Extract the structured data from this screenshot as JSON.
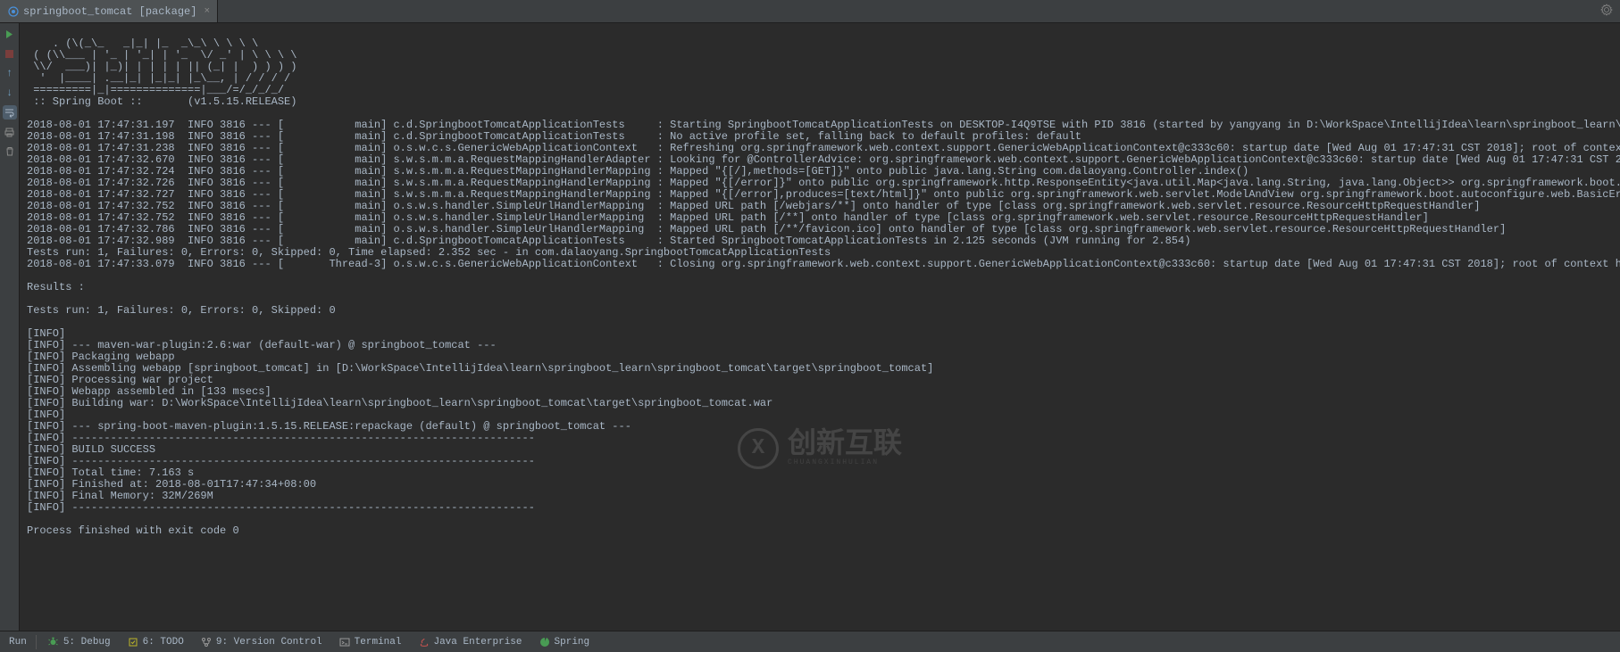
{
  "tab": {
    "label": "springboot_tomcat [package]"
  },
  "console_output": ". (\\(_\\_   _|_| |_  _\\_\\ \\ \\ \\ \\\n ( (\\\\___ | '_ | '_| | '_  \\/ _' | \\ \\ \\ \\\n \\\\/  ___)| |_)| | | | | || (_| |  ) ) ) )\n  '  |____| .__|_| |_|_| |_\\__, | / / / /\n =========|_|==============|___/=/_/_/_/\n :: Spring Boot ::       (v1.5.15.RELEASE)\n\n2018-08-01 17:47:31.197  INFO 3816 --- [           main] c.d.SpringbootTomcatApplicationTests     : Starting SpringbootTomcatApplicationTests on DESKTOP-I4Q9TSE with PID 3816 (started by yangyang in D:\\WorkSpace\\IntellijIdea\\learn\\springboot_learn\\spring\n2018-08-01 17:47:31.198  INFO 3816 --- [           main] c.d.SpringbootTomcatApplicationTests     : No active profile set, falling back to default profiles: default\n2018-08-01 17:47:31.238  INFO 3816 --- [           main] o.s.w.c.s.GenericWebApplicationContext   : Refreshing org.springframework.web.context.support.GenericWebApplicationContext@c333c60: startup date [Wed Aug 01 17:47:31 CST 2018]; root of context hier\n2018-08-01 17:47:32.670  INFO 3816 --- [           main] s.w.s.m.m.a.RequestMappingHandlerAdapter : Looking for @ControllerAdvice: org.springframework.web.context.support.GenericWebApplicationContext@c333c60: startup date [Wed Aug 01 17:47:31 CST 2018]; \n2018-08-01 17:47:32.724  INFO 3816 --- [           main] s.w.s.m.m.a.RequestMappingHandlerMapping : Mapped \"{[/],methods=[GET]}\" onto public java.lang.String com.dalaoyang.Controller.index()\n2018-08-01 17:47:32.726  INFO 3816 --- [           main] s.w.s.m.m.a.RequestMappingHandlerMapping : Mapped \"{[/error]}\" onto public org.springframework.http.ResponseEntity<java.util.Map<java.lang.String, java.lang.Object>> org.springframework.boot.autoc\n2018-08-01 17:47:32.727  INFO 3816 --- [           main] s.w.s.m.m.a.RequestMappingHandlerMapping : Mapped \"{[/error],produces=[text/html]}\" onto public org.springframework.web.servlet.ModelAndView org.springframework.boot.autoconfigure.web.BasicErrorCon\n2018-08-01 17:47:32.752  INFO 3816 --- [           main] o.s.w.s.handler.SimpleUrlHandlerMapping  : Mapped URL path [/webjars/**] onto handler of type [class org.springframework.web.servlet.resource.ResourceHttpRequestHandler]\n2018-08-01 17:47:32.752  INFO 3816 --- [           main] o.s.w.s.handler.SimpleUrlHandlerMapping  : Mapped URL path [/**] onto handler of type [class org.springframework.web.servlet.resource.ResourceHttpRequestHandler]\n2018-08-01 17:47:32.786  INFO 3816 --- [           main] o.s.w.s.handler.SimpleUrlHandlerMapping  : Mapped URL path [/**/favicon.ico] onto handler of type [class org.springframework.web.servlet.resource.ResourceHttpRequestHandler]\n2018-08-01 17:47:32.989  INFO 3816 --- [           main] c.d.SpringbootTomcatApplicationTests     : Started SpringbootTomcatApplicationTests in 2.125 seconds (JVM running for 2.854)\nTests run: 1, Failures: 0, Errors: 0, Skipped: 0, Time elapsed: 2.352 sec - in com.dalaoyang.SpringbootTomcatApplicationTests\n2018-08-01 17:47:33.079  INFO 3816 --- [       Thread-3] o.s.w.c.s.GenericWebApplicationContext   : Closing org.springframework.web.context.support.GenericWebApplicationContext@c333c60: startup date [Wed Aug 01 17:47:31 CST 2018]; root of context hierarc\n\nResults :\n\nTests run: 1, Failures: 0, Errors: 0, Skipped: 0\n\n[INFO] \n[INFO] --- maven-war-plugin:2.6:war (default-war) @ springboot_tomcat ---\n[INFO] Packaging webapp\n[INFO] Assembling webapp [springboot_tomcat] in [D:\\WorkSpace\\IntellijIdea\\learn\\springboot_learn\\springboot_tomcat\\target\\springboot_tomcat]\n[INFO] Processing war project\n[INFO] Webapp assembled in [133 msecs]\n[INFO] Building war: D:\\WorkSpace\\IntellijIdea\\learn\\springboot_learn\\springboot_tomcat\\target\\springboot_tomcat.war\n[INFO] \n[INFO] --- spring-boot-maven-plugin:1.5.15.RELEASE:repackage (default) @ springboot_tomcat ---\n[INFO] ------------------------------------------------------------------------\n[INFO] BUILD SUCCESS\n[INFO] ------------------------------------------------------------------------\n[INFO] Total time: 7.163 s\n[INFO] Finished at: 2018-08-01T17:47:34+08:00\n[INFO] Final Memory: 32M/269M\n[INFO] ------------------------------------------------------------------------\n\nProcess finished with exit code 0",
  "bottom_bar": {
    "run": "Run",
    "debug": "5: Debug",
    "todo": "6: TODO",
    "version_control": "9: Version Control",
    "terminal": "Terminal",
    "java_enterprise": "Java Enterprise",
    "spring": "Spring"
  },
  "watermark": {
    "main": "创新互联",
    "sub": "CHUANGXINHULIAN"
  }
}
